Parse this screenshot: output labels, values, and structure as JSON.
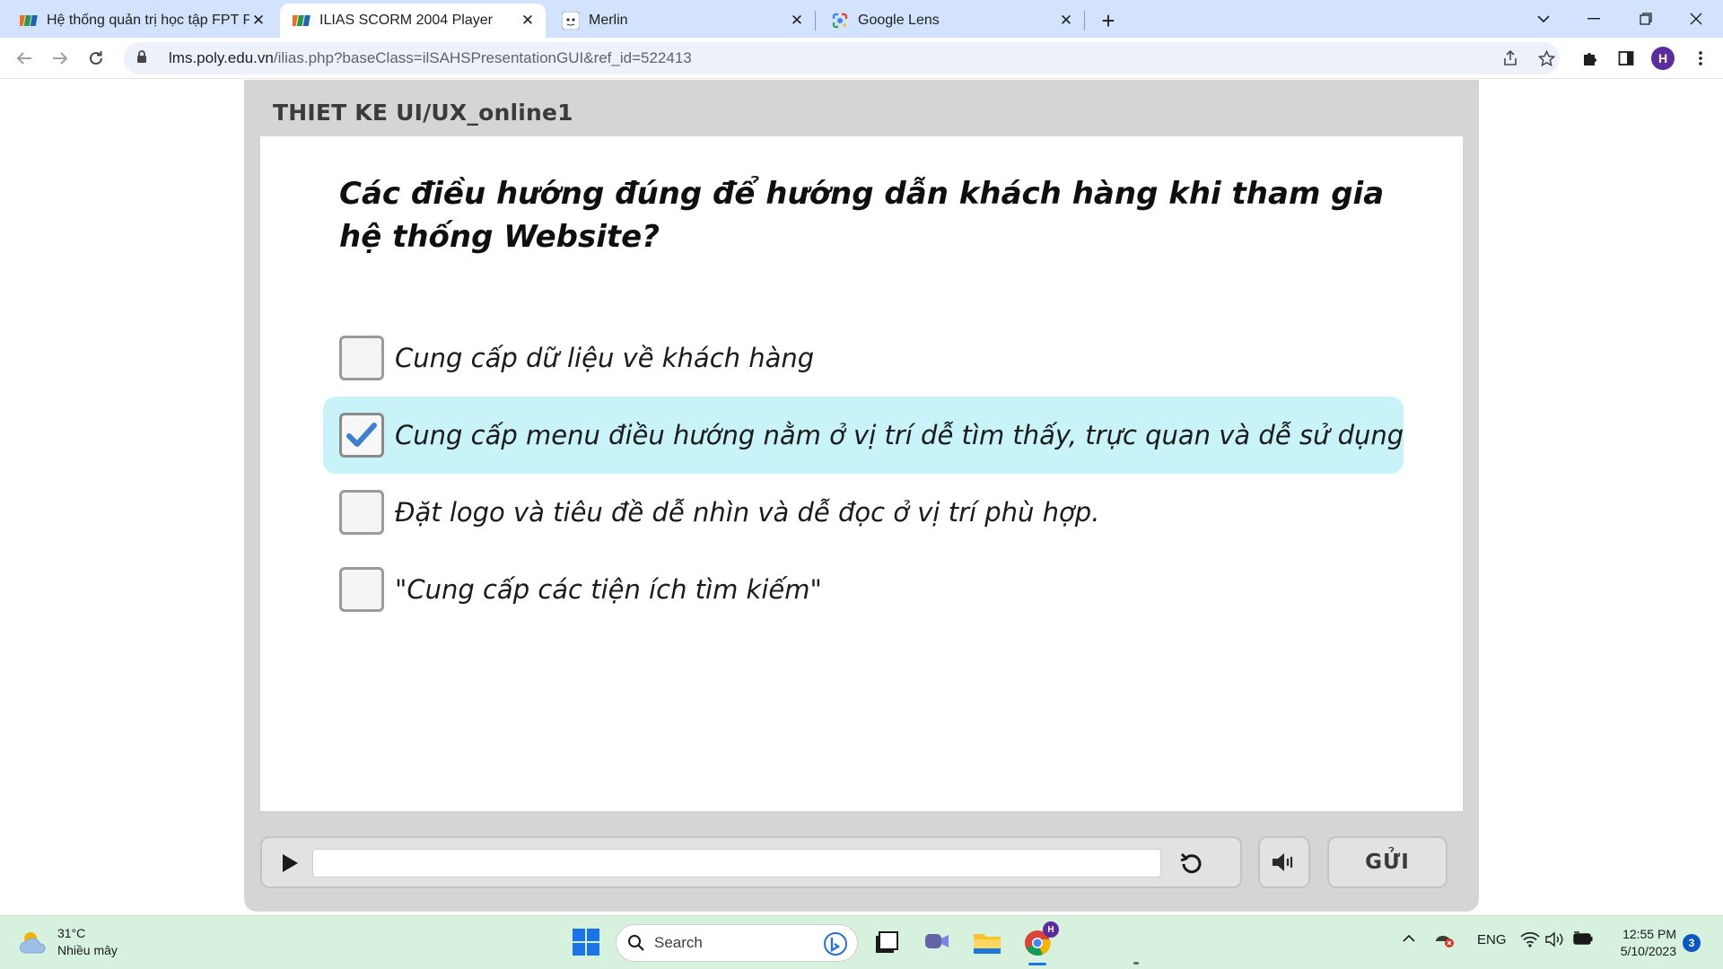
{
  "browser": {
    "tabs": [
      {
        "title": "Hệ thống quản trị học tập FPT Po",
        "favicon": "fpt-favicon",
        "active": false
      },
      {
        "title": "ILIAS SCORM 2004 Player",
        "favicon": "fpt-favicon",
        "active": true
      },
      {
        "title": "Merlin",
        "favicon": "merlin-favicon",
        "active": false
      },
      {
        "title": "Google Lens",
        "favicon": "google-lens-favicon",
        "active": false
      }
    ],
    "url_host": "lms.poly.edu.vn",
    "url_path": "/ilias.php?baseClass=ilSAHSPresentationGUI&ref_id=522413",
    "profile_initial": "H"
  },
  "player": {
    "title": "THIET KE UI/UX_online1",
    "question": "Các điều hướng đúng để hướng dẫn khách hàng khi tham gia hệ thống Website?",
    "options": [
      {
        "text": "Cung cấp dữ liệu về khách hàng",
        "checked": false
      },
      {
        "text": "Cung cấp menu điều hướng nằm ở vị trí dễ tìm thấy, trực quan và dễ sử dụng",
        "checked": true
      },
      {
        "text": "Đặt logo và tiêu đề dễ nhìn và dễ đọc ở vị trí phù hợp.",
        "checked": false
      },
      {
        "text": "\"Cung cấp các tiện ích tìm kiếm\"",
        "checked": false
      }
    ],
    "submit_label": "GỬI",
    "colors": {
      "selected_bg": "#c8f3f9",
      "check": "#3d7fd1"
    }
  },
  "taskbar": {
    "weather_temp": "31°C",
    "weather_desc": "Nhiều mây",
    "search_placeholder": "Search",
    "language": "ENG",
    "time": "12:55 PM",
    "date": "5/10/2023",
    "notification_count": "3",
    "profile_badge": "H"
  }
}
